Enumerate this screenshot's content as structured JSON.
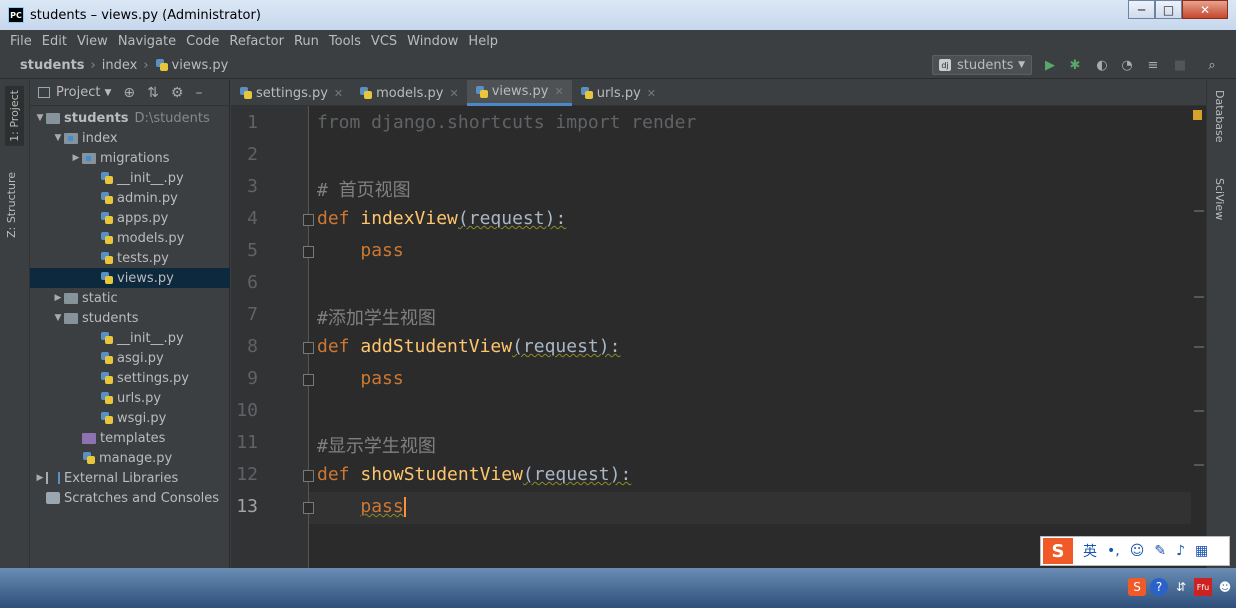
{
  "window": {
    "title": "students – views.py (Administrator)",
    "logo": "PC",
    "minimize_glyph": "─",
    "maximize_glyph": "□",
    "close_glyph": "✕"
  },
  "menu": [
    "File",
    "Edit",
    "View",
    "Navigate",
    "Code",
    "Refactor",
    "Run",
    "Tools",
    "VCS",
    "Window",
    "Help"
  ],
  "breadcrumb": {
    "project": "students",
    "folder": "index",
    "file": "views.py"
  },
  "run_config": {
    "label": "students",
    "icon": "dj"
  },
  "toolbar_icons": [
    "run-icon",
    "debug-icon",
    "coverage-icon",
    "profile-icon",
    "build-icon",
    "stop-icon",
    "search-icon"
  ],
  "left_tabs": {
    "project": "1: Project",
    "structure": "Z: Structure"
  },
  "right_tabs": {
    "database": "Database",
    "sciview": "SciView"
  },
  "project_panel": {
    "title": "Project",
    "tree": [
      {
        "label": "students",
        "extra": "D:\\students",
        "depth": 0,
        "type": "folder",
        "open": true,
        "bold": true
      },
      {
        "label": "index",
        "depth": 1,
        "type": "module",
        "open": true
      },
      {
        "label": "migrations",
        "depth": 2,
        "type": "module",
        "open": false
      },
      {
        "label": "__init__.py",
        "depth": 3,
        "type": "py"
      },
      {
        "label": "admin.py",
        "depth": 3,
        "type": "py"
      },
      {
        "label": "apps.py",
        "depth": 3,
        "type": "py"
      },
      {
        "label": "models.py",
        "depth": 3,
        "type": "py"
      },
      {
        "label": "tests.py",
        "depth": 3,
        "type": "py"
      },
      {
        "label": "views.py",
        "depth": 3,
        "type": "py",
        "selected": true
      },
      {
        "label": "static",
        "depth": 1,
        "type": "folder",
        "open": false
      },
      {
        "label": "students",
        "depth": 1,
        "type": "folder",
        "open": true
      },
      {
        "label": "__init__.py",
        "depth": 3,
        "type": "py"
      },
      {
        "label": "asgi.py",
        "depth": 3,
        "type": "py"
      },
      {
        "label": "settings.py",
        "depth": 3,
        "type": "py"
      },
      {
        "label": "urls.py",
        "depth": 3,
        "type": "py"
      },
      {
        "label": "wsgi.py",
        "depth": 3,
        "type": "py"
      },
      {
        "label": "templates",
        "depth": 2,
        "type": "purple"
      },
      {
        "label": "manage.py",
        "depth": 2,
        "type": "py"
      },
      {
        "label": "External Libraries",
        "depth": 0,
        "type": "lib",
        "open": false
      },
      {
        "label": "Scratches and Consoles",
        "depth": 0,
        "type": "scratch"
      }
    ]
  },
  "editor_tabs": [
    {
      "label": "settings.py",
      "active": false
    },
    {
      "label": "models.py",
      "active": false
    },
    {
      "label": "views.py",
      "active": true
    },
    {
      "label": "urls.py",
      "active": false
    }
  ],
  "code_lines": [
    {
      "n": "1",
      "text": "from django.shortcuts import render"
    },
    {
      "n": "2",
      "text": ""
    },
    {
      "n": "3",
      "text": "# 首页视图"
    },
    {
      "n": "4",
      "text": "def indexView(request):"
    },
    {
      "n": "5",
      "text": "    pass"
    },
    {
      "n": "6",
      "text": ""
    },
    {
      "n": "7",
      "text": "#添加学生视图"
    },
    {
      "n": "8",
      "text": "def addStudentView(request):"
    },
    {
      "n": "9",
      "text": "    pass"
    },
    {
      "n": "10",
      "text": ""
    },
    {
      "n": "11",
      "text": "#显示学生视图"
    },
    {
      "n": "12",
      "text": "def showStudentView(request):"
    },
    {
      "n": "13",
      "text": "    pass"
    }
  ],
  "ime_bar": {
    "logo": "S",
    "mode": "英",
    "punct": "•,",
    "icons": [
      "emoji-icon",
      "brush-icon",
      "mic-icon",
      "grid-icon"
    ]
  },
  "colors": {
    "keyword": "#cc7832",
    "function": "#ffc66d",
    "comment": "#808080",
    "text": "#a9b7c6",
    "bg": "#2b2b2b",
    "accent": "#4a88c7"
  }
}
